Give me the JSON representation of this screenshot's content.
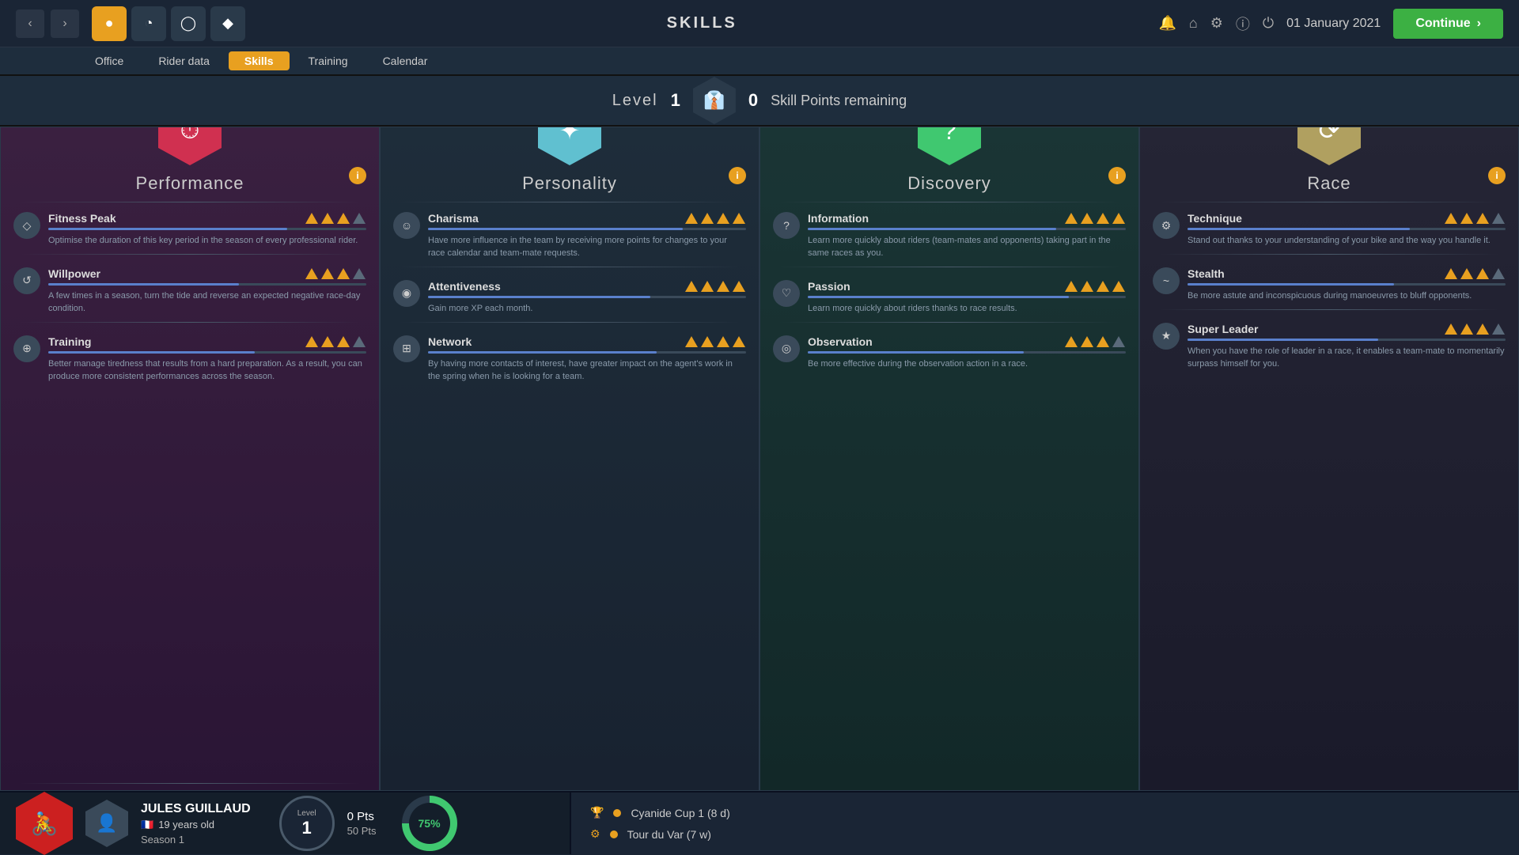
{
  "topBar": {
    "title": "SKILLS",
    "date": "01 January 2021",
    "continueLabel": "Continue"
  },
  "subNav": {
    "items": [
      {
        "label": "Office",
        "active": false
      },
      {
        "label": "Rider data",
        "active": false
      },
      {
        "label": "Skills",
        "active": true
      },
      {
        "label": "Training",
        "active": false
      },
      {
        "label": "Calendar",
        "active": false
      }
    ]
  },
  "levelBar": {
    "levelLabel": "Level",
    "levelNum": "1",
    "skillPointsNum": "0",
    "skillPointsLabel": "Skill Points remaining"
  },
  "cards": [
    {
      "id": "performance",
      "title": "Performance",
      "icon": "⏱",
      "hexClass": "hex-performance",
      "skills": [
        {
          "name": "Fitness Peak",
          "icon": "◇",
          "bars": 4,
          "filled": 3,
          "desc": "Optimise the duration of this key period in the season of every professional rider.",
          "progress": 75
        },
        {
          "name": "Willpower",
          "icon": "↺",
          "bars": 4,
          "filled": 3,
          "desc": "A few times in a season, turn the tide and reverse an expected negative race-day condition.",
          "progress": 60
        },
        {
          "name": "Training",
          "icon": "⊕",
          "bars": 4,
          "filled": 3,
          "desc": "Better manage tiredness that results from a hard preparation. As a result, you can produce more consistent performances across the season.",
          "progress": 65
        }
      ]
    },
    {
      "id": "personality",
      "title": "Personality",
      "icon": "✦",
      "hexClass": "hex-personality",
      "skills": [
        {
          "name": "Charisma",
          "icon": "☺",
          "bars": 4,
          "filled": 4,
          "desc": "Have more influence in the team by receiving more points for changes to your race calendar and team-mate requests.",
          "progress": 80
        },
        {
          "name": "Attentiveness",
          "icon": "◉",
          "bars": 4,
          "filled": 4,
          "desc": "Gain more XP each month.",
          "progress": 70
        },
        {
          "name": "Network",
          "icon": "⊞",
          "bars": 4,
          "filled": 4,
          "desc": "By having more contacts of interest, have greater impact on the agent's work in the spring when he is looking for a team.",
          "progress": 72
        }
      ]
    },
    {
      "id": "discovery",
      "title": "Discovery",
      "icon": "?",
      "hexClass": "hex-discovery",
      "skills": [
        {
          "name": "Information",
          "icon": "?",
          "bars": 4,
          "filled": 4,
          "desc": "Learn more quickly about riders (team-mates and opponents) taking part in the same races as you.",
          "progress": 78
        },
        {
          "name": "Passion",
          "icon": "♡",
          "bars": 4,
          "filled": 4,
          "desc": "Learn more quickly about riders thanks to race results.",
          "progress": 82
        },
        {
          "name": "Observation",
          "icon": "◎",
          "bars": 4,
          "filled": 3,
          "desc": "Be more effective during the observation action in a race.",
          "progress": 68
        }
      ]
    },
    {
      "id": "race",
      "title": "Race",
      "icon": "⟳",
      "hexClass": "hex-race",
      "skills": [
        {
          "name": "Technique",
          "icon": "⚙",
          "bars": 4,
          "filled": 3,
          "desc": "Stand out thanks to your understanding of your bike and the way you handle it.",
          "progress": 70
        },
        {
          "name": "Stealth",
          "icon": "~",
          "bars": 4,
          "filled": 3,
          "desc": "Be more astute and inconspicuous during manoeuvres to bluff opponents.",
          "progress": 65
        },
        {
          "name": "Super Leader",
          "icon": "★",
          "bars": 4,
          "filled": 3,
          "desc": "When you have the role of leader in a race, it enables a team-mate to momentarily surpass himself for you.",
          "progress": 60
        }
      ]
    }
  ],
  "bottomBar": {
    "riderName": "JULES GUILLAUD",
    "riderAge": "19 years old",
    "riderSeason": "Season 1",
    "levelLabel": "Level",
    "levelNum": "1",
    "ptsCurrentLabel": "0 Pts",
    "ptsTotalLabel": "50 Pts",
    "progressPct": "75%",
    "races": [
      {
        "icon": "🏆",
        "label": "Cyanide Cup 1 (8 d)"
      },
      {
        "icon": "⚙",
        "label": "Tour du Var (7 w)"
      }
    ]
  }
}
